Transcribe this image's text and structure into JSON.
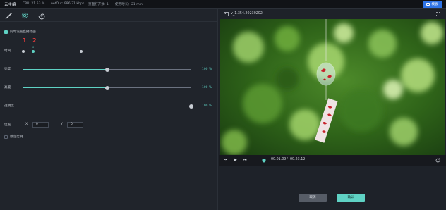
{
  "topbar": {
    "title": "云主编",
    "cpu": "CPU: 21.53 %",
    "netout": "netOut: 986.31 kbps",
    "conn": "页面打开数: 1",
    "duration": "使用时长：21 min",
    "button_label": "模板"
  },
  "toolbar": {
    "tools": [
      "brush-icon",
      "gear-icon",
      "spiral-icon"
    ]
  },
  "panel": {
    "sync_checkbox_label": "同时设置直播动画",
    "sync_checked": true,
    "time_label": "时间",
    "marker_1": "1",
    "marker_2": "2",
    "marker_2_sub": "0",
    "brightness_label": "亮度",
    "brightness_value": "100 %",
    "brightness_level": 0.5,
    "contrast_label": "高度",
    "contrast_value": "100 %",
    "contrast_level": 0.5,
    "opacity_label": "透明度",
    "opacity_value": "100 %",
    "opacity_level": 1.0,
    "position_label": "位置",
    "x_label": "X",
    "x_value": "0",
    "y_label": "Y",
    "y_value": "0",
    "lock_label": "锁定比例",
    "lock_checked": false
  },
  "preview": {
    "file_name": "v_1.354.20230202",
    "time_current": "00.01.09",
    "time_sep": "/",
    "time_total": "00.23.12",
    "progress": 0.05
  },
  "actions": {
    "cancel_label": "取消",
    "confirm_label": "确认"
  },
  "colors": {
    "accent": "#5fd2c4",
    "primary": "#2f74e6",
    "marker": "#e23b3b"
  }
}
